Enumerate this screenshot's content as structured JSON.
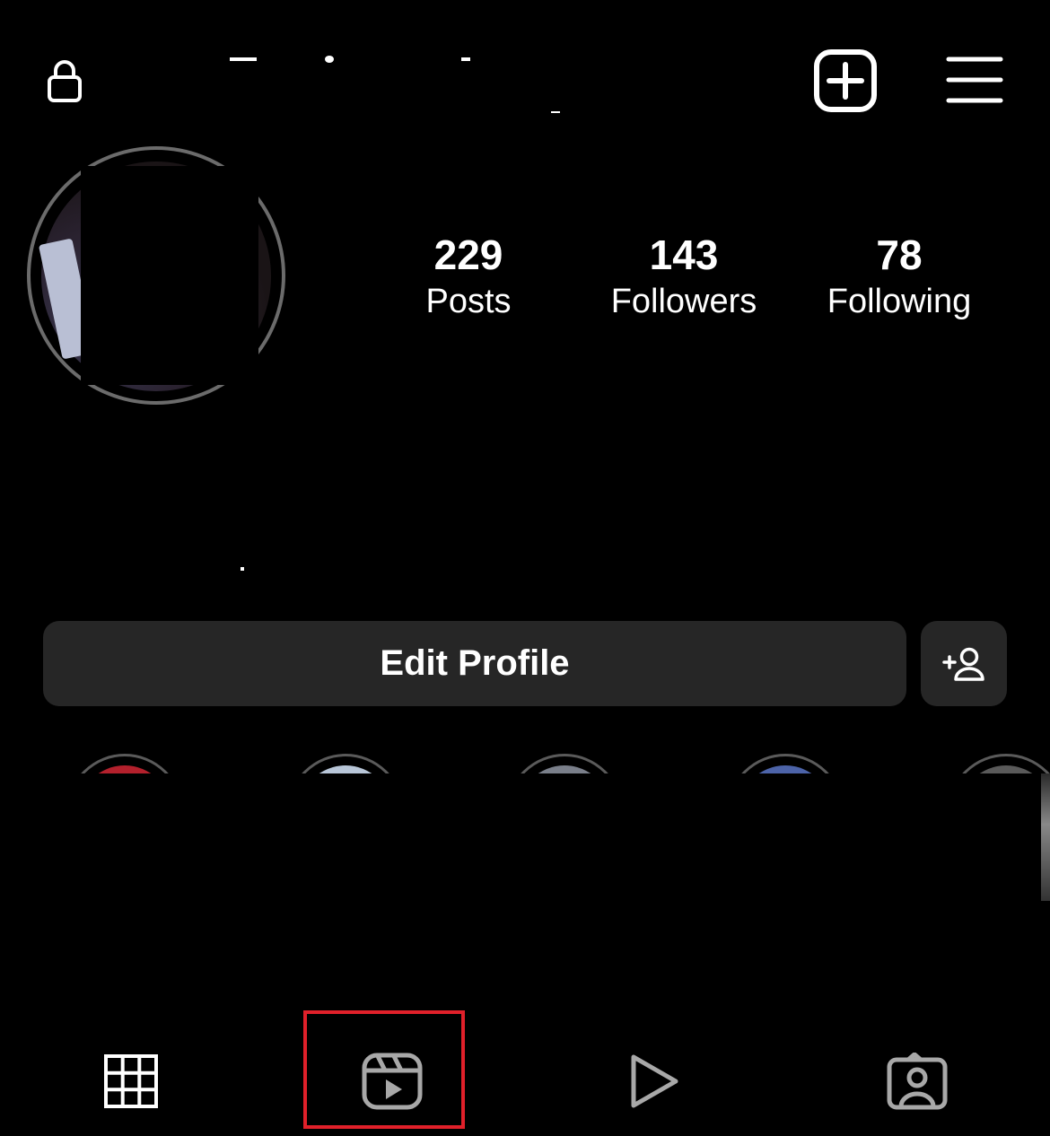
{
  "header": {
    "lock_icon": "lock-icon",
    "add_icon": "plus-square-icon",
    "menu_icon": "hamburger-menu-icon"
  },
  "profile": {
    "stats": [
      {
        "value": "229",
        "label": "Posts"
      },
      {
        "value": "143",
        "label": "Followers"
      },
      {
        "value": "78",
        "label": "Following"
      }
    ],
    "edit_button_label": "Edit Profile",
    "add_user_icon": "add-person-icon"
  },
  "tabs": [
    {
      "icon": "grid-icon"
    },
    {
      "icon": "reels-icon",
      "highlighted": true
    },
    {
      "icon": "play-icon"
    },
    {
      "icon": "tagged-person-icon"
    }
  ],
  "colors": {
    "background": "#000000",
    "button_bg": "#262626",
    "highlight_box": "#e0202a",
    "inactive_icon": "#a8a8a8"
  }
}
